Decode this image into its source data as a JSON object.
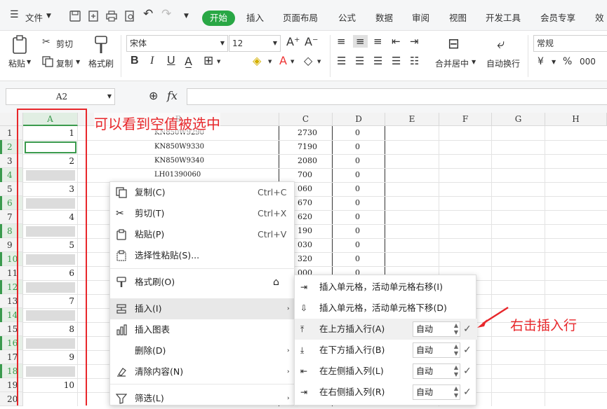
{
  "menubar": {
    "file_label": "文件",
    "start_label": "开始",
    "tabs": [
      "插入",
      "页面布局",
      "公式",
      "数据",
      "审阅",
      "视图",
      "开发工具",
      "会员专享",
      "效"
    ]
  },
  "ribbon": {
    "paste_label": "粘贴",
    "cut_label": "剪切",
    "copy_label": "复制",
    "format_painter_label": "格式刷",
    "font_name": "宋体",
    "font_size": "12",
    "merge_label": "合并居中",
    "wrap_label": "自动换行",
    "number_format": "常规",
    "currency_symbol": "¥",
    "percent_symbol": "%",
    "thousands_symbol": "000"
  },
  "formula_bar": {
    "name_box": "A2",
    "fx_label": "fx"
  },
  "sheet": {
    "columns": [
      "A",
      "B",
      "C",
      "D",
      "E",
      "F",
      "G",
      "H"
    ],
    "rows": [
      "1",
      "2",
      "3",
      "4",
      "5",
      "6",
      "7",
      "8",
      "9",
      "10",
      "11",
      "12",
      "13",
      "14",
      "15",
      "16",
      "17",
      "18",
      "19",
      "20"
    ],
    "col_a_values": [
      "1",
      "2",
      "3",
      "4",
      "5",
      "6",
      "7",
      "8",
      "9",
      "10"
    ],
    "col_b_values": [
      "KN850W9290",
      "KN850W9330",
      "KN850W9340",
      "LH01390060"
    ],
    "col_c_values": [
      "2730",
      "7190",
      "2080",
      "700",
      "060",
      "670",
      "620",
      "190",
      "030",
      "320",
      "000"
    ],
    "col_d_values": [
      "0",
      "0",
      "0",
      "0",
      "0",
      "0",
      "0",
      "0",
      "0",
      "0",
      "0"
    ]
  },
  "annotations": {
    "top_note": "可以看到空值被选中",
    "side_note": "右击插入行",
    "color": "#e8272b"
  },
  "context_menu": {
    "items": [
      {
        "label": "复制(C)",
        "shortcut": "Ctrl+C",
        "icon": "copy-icon"
      },
      {
        "label": "剪切(T)",
        "shortcut": "Ctrl+X",
        "icon": "cut-icon"
      },
      {
        "label": "粘贴(P)",
        "shortcut": "Ctrl+V",
        "icon": "paste-icon"
      },
      {
        "label": "选择性粘贴(S)...",
        "shortcut": "",
        "icon": "paste-special-icon"
      },
      {
        "label": "格式刷(O)",
        "shortcut": "",
        "icon": "format-painter-icon"
      },
      {
        "label": "插入(I)",
        "shortcut": "",
        "icon": "insert-icon"
      },
      {
        "label": "插入图表",
        "shortcut": "",
        "icon": "chart-icon"
      },
      {
        "label": "删除(D)",
        "shortcut": "",
        "icon": ""
      },
      {
        "label": "清除内容(N)",
        "shortcut": "",
        "icon": "clear-icon"
      },
      {
        "label": "筛选(L)",
        "shortcut": "",
        "icon": "filter-icon"
      }
    ]
  },
  "insert_submenu": {
    "items": [
      {
        "label": "插入单元格，活动单元格右移(I)"
      },
      {
        "label": "插入单元格，活动单元格下移(D)"
      },
      {
        "label": "在上方插入行(A)",
        "value": "自动"
      },
      {
        "label": "在下方插入行(B)",
        "value": "自动"
      },
      {
        "label": "在左侧插入列(L)",
        "value": "自动"
      },
      {
        "label": "在右侧插入列(R)",
        "value": "自动"
      }
    ]
  }
}
